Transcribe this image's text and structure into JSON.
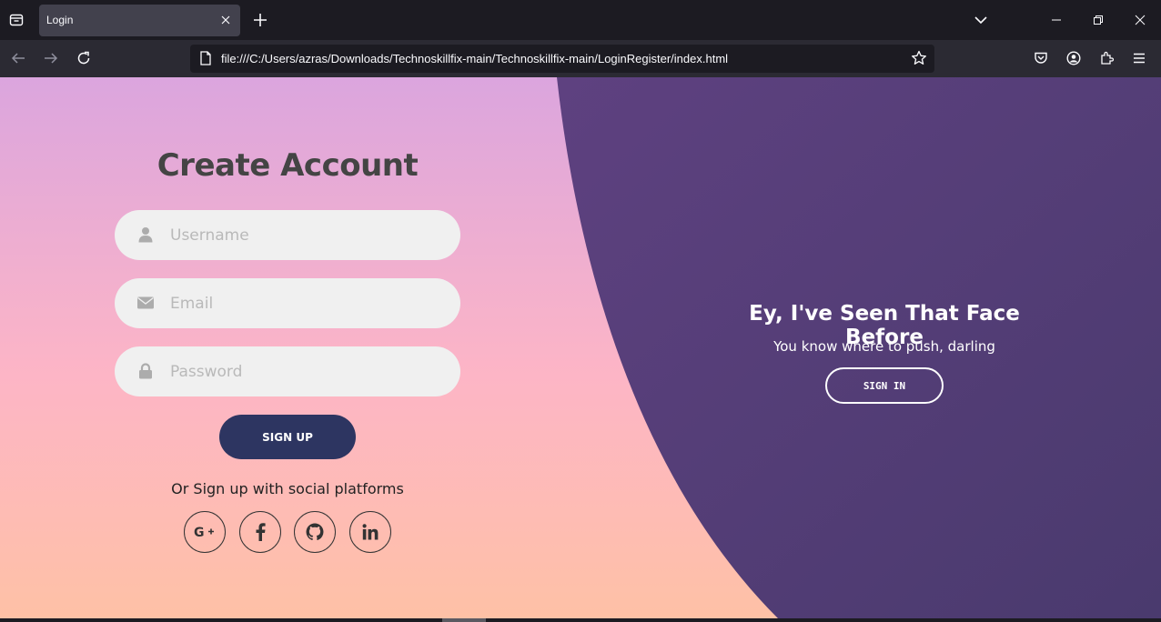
{
  "browser": {
    "tab_title": "Login",
    "url": "file:///C:/Users/azras/Downloads/Technoskillfix-main/Technoskillfix-main/LoginRegister/index.html"
  },
  "signup": {
    "title": "Create Account",
    "username_placeholder": "Username",
    "email_placeholder": "Email",
    "password_placeholder": "Password",
    "button_label": "SIGN UP",
    "social_text": "Or Sign up with social platforms"
  },
  "panel": {
    "title": "Ey, I've Seen That Face Before",
    "text": "You know where to push, darling",
    "button_label": "SIGN IN"
  },
  "colors": {
    "accent_button": "#2d3561",
    "panel_purple": "#5a3f7d",
    "gradient_top": "#dba5de",
    "gradient_bottom": "#fec1a6"
  },
  "icons": {
    "social": [
      "google-plus-icon",
      "facebook-icon",
      "github-icon",
      "linkedin-icon"
    ]
  }
}
